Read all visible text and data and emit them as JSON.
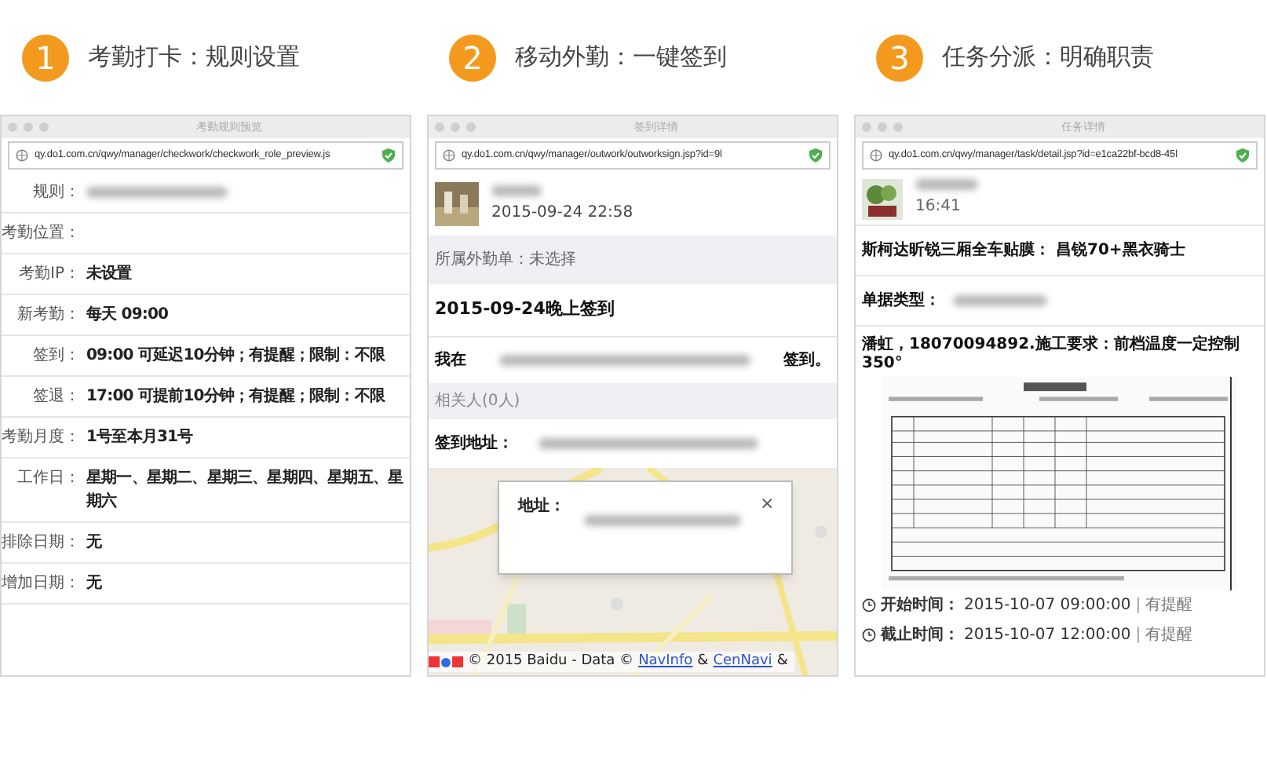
{
  "sections": [
    {
      "kind": "rules",
      "number": "1",
      "title": "考勤打卡：规则设置",
      "window": {
        "title": "考勤规则预览",
        "url": "qy.do1.com.cn/qwy/manager/checkwork/checkwork_role_preview.js"
      },
      "rows": [
        {
          "label": "规则：",
          "redacted": true
        },
        {
          "label": "考勤位置："
        },
        {
          "label": "考勤IP：",
          "value": "未设置"
        },
        {
          "label": "新考勤：",
          "value": "每天 09:00"
        },
        {
          "label": "签到：",
          "value": "09:00 可延迟10分钟；有提醒；限制：不限"
        },
        {
          "label": "签退：",
          "value": "17:00 可提前10分钟；有提醒；限制：不限"
        },
        {
          "label": "考勤月度：",
          "value": "1号至本月31号"
        },
        {
          "label": "工作日：",
          "value": "星期一、星期二、星期三、星期四、星期五、星期六"
        },
        {
          "label": "排除日期：",
          "value": "无"
        },
        {
          "label": "增加日期：",
          "value": "无"
        }
      ]
    },
    {
      "kind": "checkin",
      "number": "2",
      "title": "移动外勤：一键签到",
      "window": {
        "title": "签到详情",
        "url": "qy.do1.com.cn/qwy/manager/outwork/outworksign.jsp?id=9l"
      },
      "time": "2015-09-24 22:58",
      "form_line": "所属外勤单：未选择",
      "heading": "2015-09-24晚上签到",
      "sentence_start": "我在",
      "sentence_end": "签到。",
      "related": "相关人(0人)",
      "address_label": "签到地址：",
      "popup": {
        "label": "地址：",
        "close": "×"
      },
      "attribution": [
        {
          "text": "© 2015 Baidu - Data ©",
          "link": false
        },
        {
          "text": "NavInfo",
          "link": true
        },
        {
          "text": "&",
          "link": false
        },
        {
          "text": "CenNavi",
          "link": true
        },
        {
          "text": "&",
          "link": false
        }
      ]
    },
    {
      "kind": "task",
      "number": "3",
      "title": "任务分派：明确职责",
      "window": {
        "title": "任务详情",
        "url": "qy.do1.com.cn/qwy/manager/task/detail.jsp?id=e1ca22bf-bcd8-45l"
      },
      "time": "16:41",
      "subject": "斯柯达昕锐三厢全车贴膜： 昌锐70+黑衣骑士",
      "type_label": "单据类型：",
      "note": "潘虹，18070094892.施工要求：前档温度一定控制350°",
      "times": [
        {
          "label": "开始时间：",
          "value": "2015-10-07 09:00:00",
          "separator": "|",
          "reminder": "有提醒"
        },
        {
          "label": "截止时间：",
          "value": "2015-10-07 12:00:00",
          "separator": "|",
          "reminder": "有提醒"
        }
      ]
    }
  ]
}
